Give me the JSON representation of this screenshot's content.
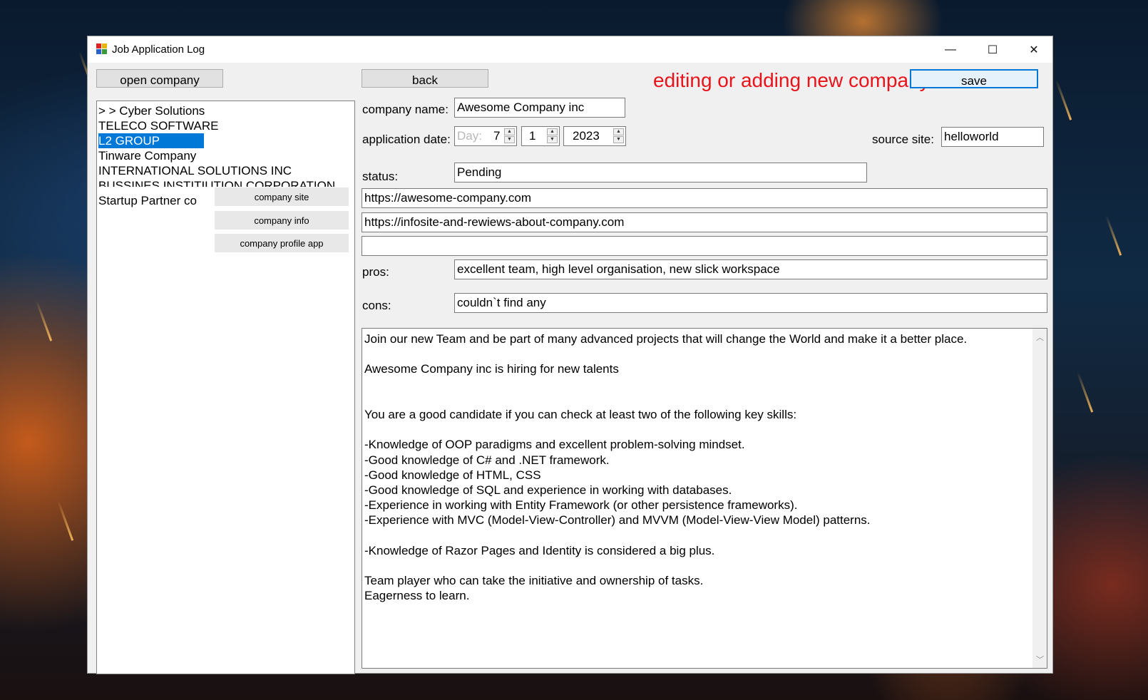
{
  "window": {
    "title": "Job Application Log",
    "minimize_glyph": "—",
    "maximize_glyph": "☐",
    "close_glyph": "✕"
  },
  "toolbar": {
    "open_company_label": "open company",
    "back_label": "back",
    "heading": "editing or adding new company",
    "save_label": "save"
  },
  "company_list": {
    "items": [
      "> > Cyber Solutions",
      "TELECO SOFTWARE",
      "L2 GROUP",
      "Tinware Company",
      "INTERNATIONAL SOLUTIONS INC",
      "BUSSINES INSTITIUTION CORPORATION",
      "Startup Partner co"
    ],
    "selected_index": 2
  },
  "side_buttons": {
    "company_site": "company site",
    "company_info": "company info",
    "company_profile_app": "company profile app"
  },
  "form": {
    "company_name_label": "company name:",
    "company_name_value": "Awesome Company inc",
    "application_date_label": "application date:",
    "day_placeholder": "Day:",
    "day_value": "7",
    "month_value": "1",
    "year_value": "2023",
    "source_site_label": "source site:",
    "source_site_value": "helloworld",
    "status_label": "status:",
    "status_value": "Pending",
    "url_company_site": "https://awesome-company.com",
    "url_info_site": "https://infosite-and-rewiews-about-company.com",
    "url_profile_app": "",
    "pros_label": "pros:",
    "pros_value": "excellent team, high level organisation, new slick workspace",
    "cons_label": "cons:",
    "cons_value": "couldn`t find any"
  },
  "description": {
    "lines": [
      "Join our new Team and be part of many advanced projects that will change the World and make it a better place.",
      "",
      "Awesome Company inc is hiring for new talents",
      "",
      "",
      "You are a good candidate if you can check at least two of the following key skills:",
      "",
      "-Knowledge of OOP paradigms and excellent problem-solving mindset.",
      "-Good knowledge of C# and .NET framework.",
      "-Good knowledge of HTML, CSS",
      "-Good knowledge of SQL and experience in working with databases.",
      "-Experience in working with Entity Framework (or other persistence frameworks).",
      "-Experience with MVC (Model-View-Controller) and MVVM (Model-View-View Model) patterns.",
      "",
      "-Knowledge of Razor Pages and Identity is considered a big plus.",
      "",
      "Team player who can take the initiative and ownership of tasks.",
      "Eagerness to learn."
    ]
  },
  "colors": {
    "heading": "#e8141c",
    "selection": "#0078d7",
    "window_bg": "#f0f0f0"
  }
}
